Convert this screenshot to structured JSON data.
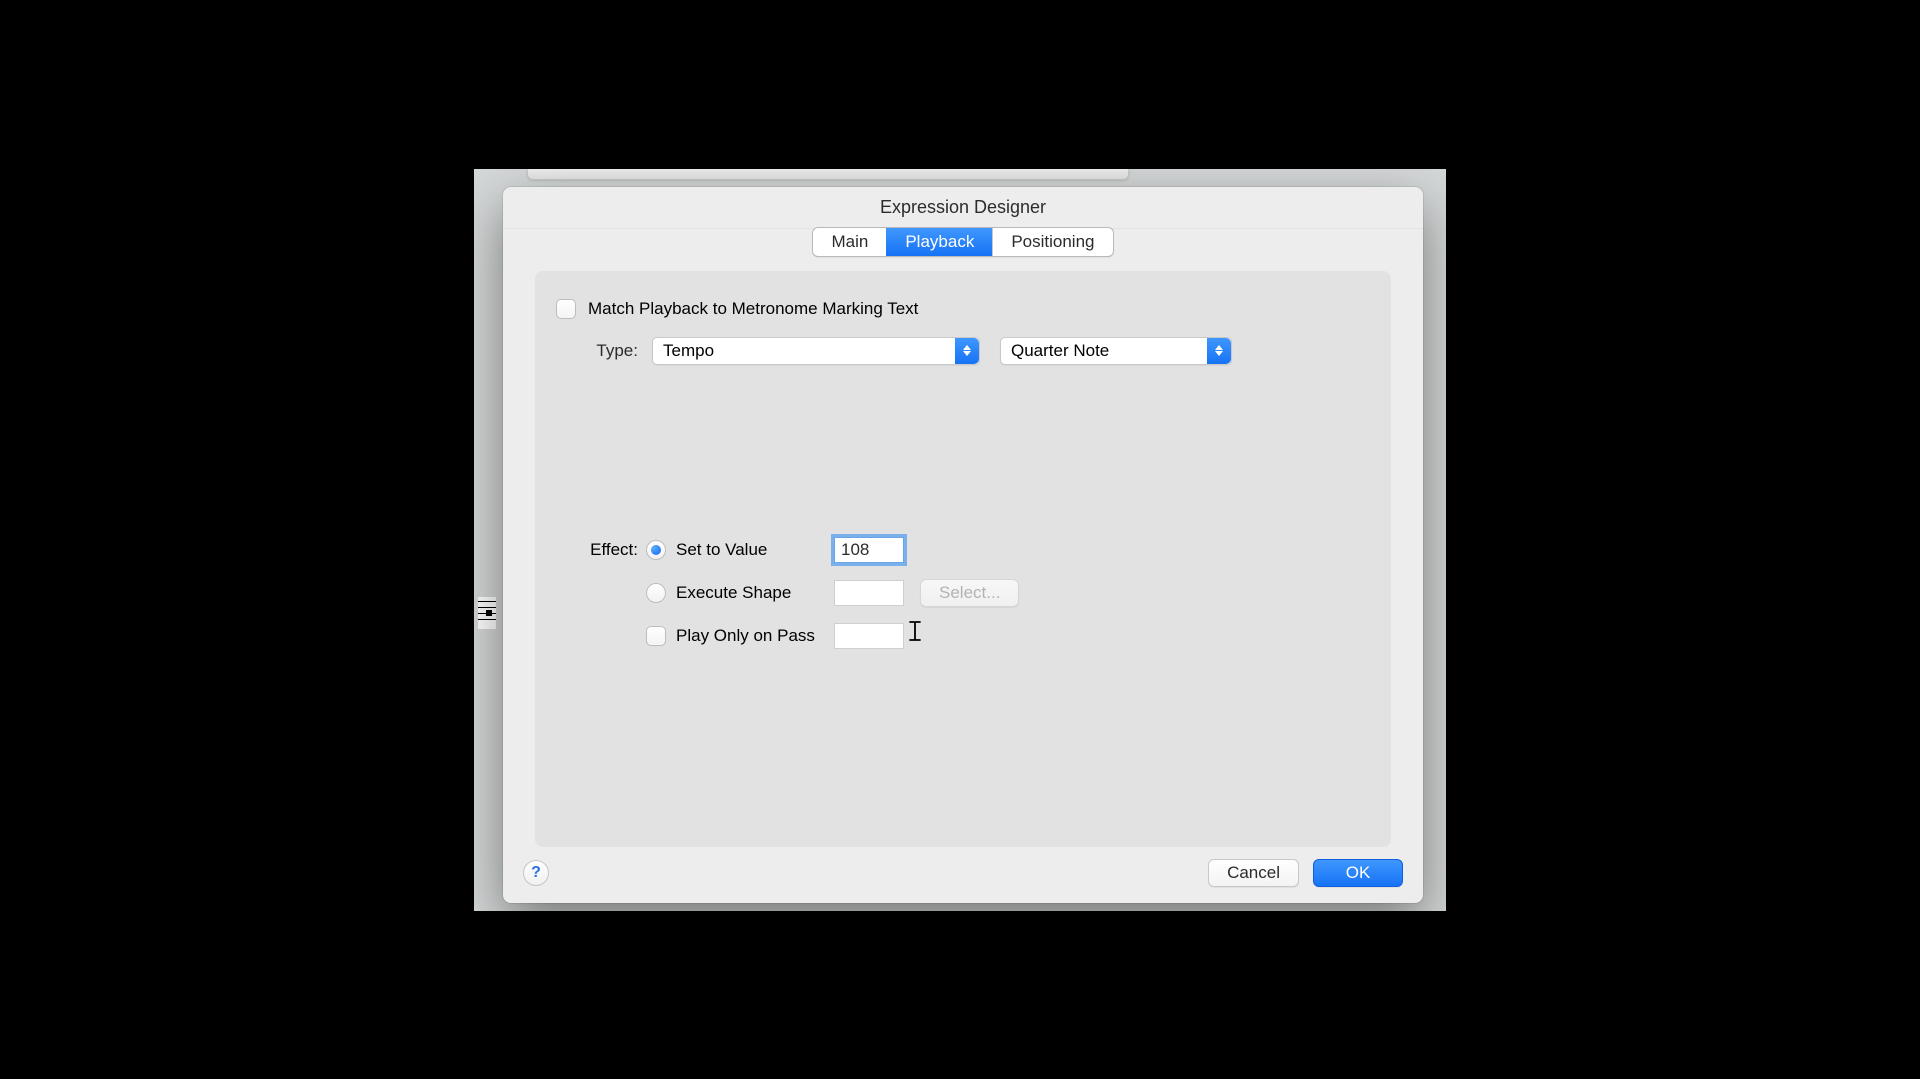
{
  "dialog": {
    "title": "Expression Designer",
    "tabs": {
      "main": "Main",
      "playback": "Playback",
      "positioning": "Positioning",
      "active": "playback"
    },
    "match_metronome_label": "Match Playback to Metronome Marking Text",
    "type_label": "Type:",
    "type_value": "Tempo",
    "note_value": "Quarter Note",
    "effect_label": "Effect:",
    "options": {
      "set_to_value": "Set to Value",
      "execute_shape": "Execute Shape",
      "play_only_on_pass": "Play Only on Pass"
    },
    "set_value": "108",
    "select_button": "Select...",
    "help_tooltip": "?",
    "buttons": {
      "cancel": "Cancel",
      "ok": "OK"
    }
  }
}
